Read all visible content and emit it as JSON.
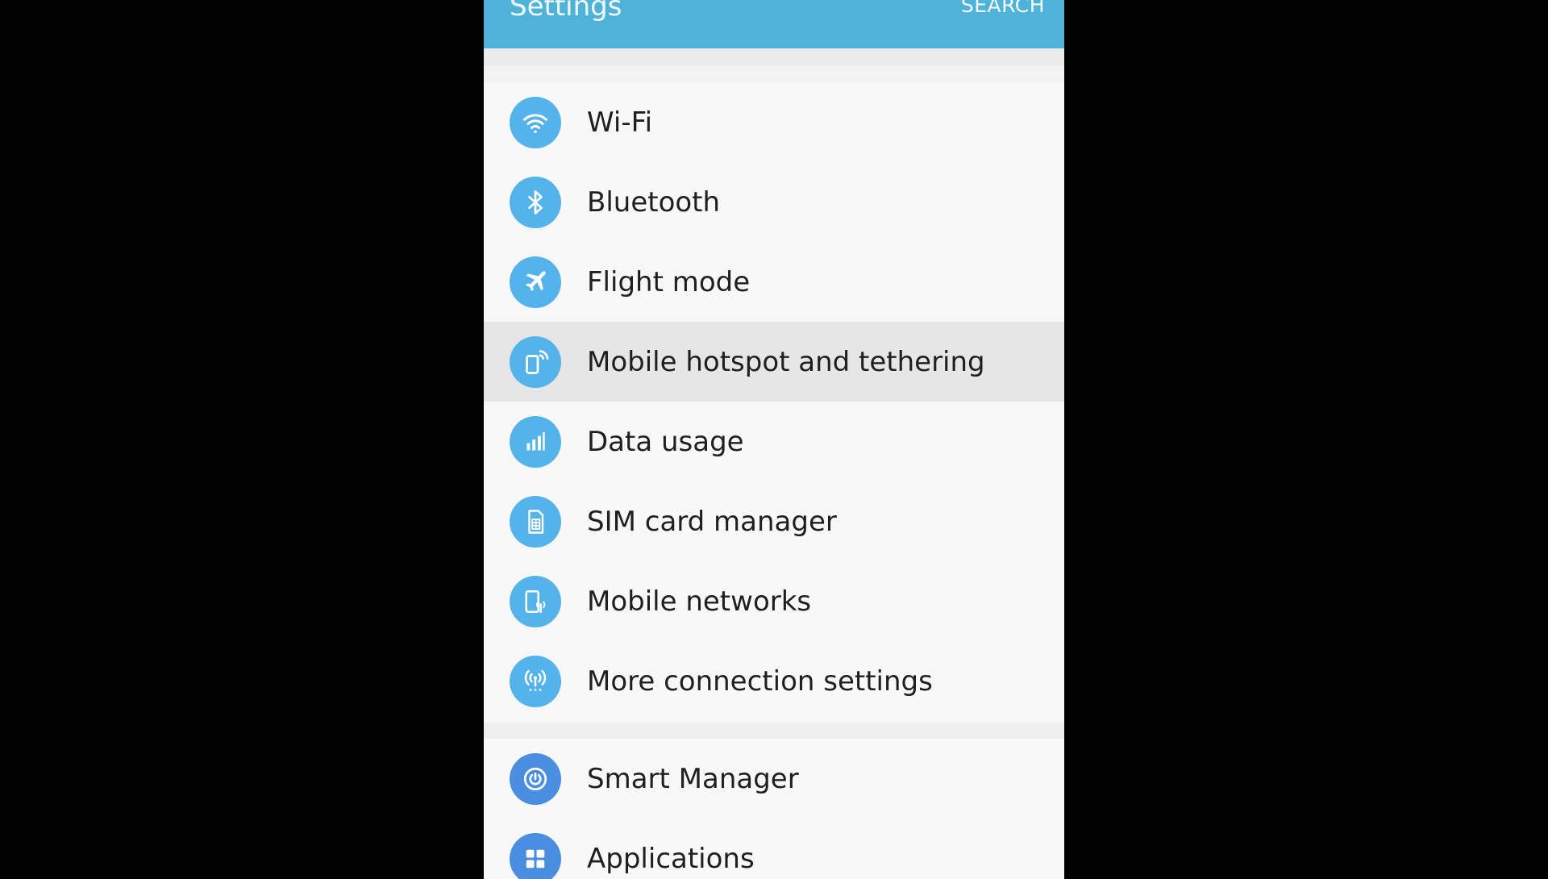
{
  "appbar": {
    "title": "Settings",
    "search_label": "SEARCH",
    "color": "#4fb2d8"
  },
  "connections": [
    {
      "label": "Wi-Fi",
      "icon": "wifi-icon"
    },
    {
      "label": "Bluetooth",
      "icon": "bluetooth-icon"
    },
    {
      "label": "Flight mode",
      "icon": "airplane-icon"
    },
    {
      "label": "Mobile hotspot and tethering",
      "icon": "hotspot-icon",
      "highlighted": true
    },
    {
      "label": "Data usage",
      "icon": "bar-chart-icon"
    },
    {
      "label": "SIM card manager",
      "icon": "sim-card-icon"
    },
    {
      "label": "Mobile networks",
      "icon": "mobile-network-icon"
    },
    {
      "label": "More connection settings",
      "icon": "antenna-icon"
    }
  ],
  "device": [
    {
      "label": "Smart Manager",
      "icon": "smart-manager-icon"
    },
    {
      "label": "Applications",
      "icon": "apps-grid-icon"
    }
  ],
  "colors": {
    "icon_bg": "#53b3ea",
    "icon_bg_dark": "#4a8ee0",
    "highlight": "#e6e6e6"
  }
}
